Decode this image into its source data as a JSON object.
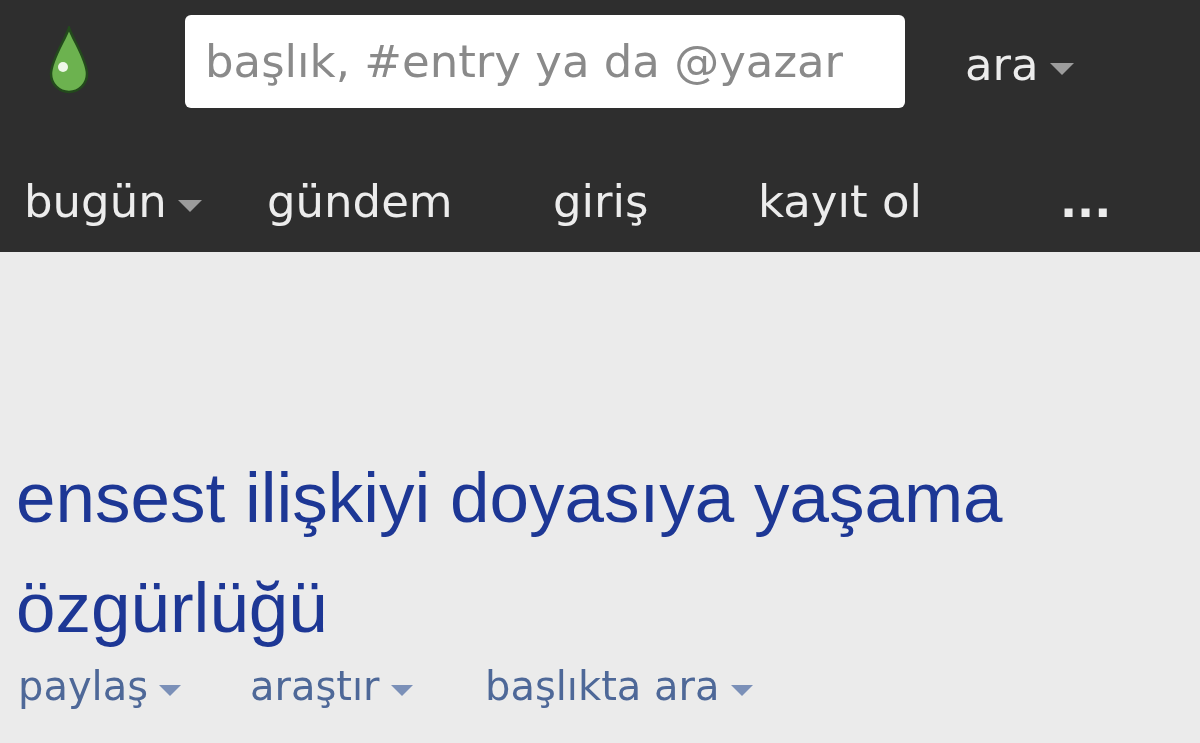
{
  "search": {
    "placeholder": "başlık, #entry ya da @yazar",
    "button": {
      "label": "ara",
      "has_menu": true
    }
  },
  "nav": [
    {
      "label": "bugün",
      "has_menu": true
    },
    {
      "label": "gündem",
      "has_menu": false
    },
    {
      "label": "giriş",
      "has_menu": false
    },
    {
      "label": "kayıt ol",
      "has_menu": false
    },
    {
      "label": "...",
      "has_menu": false
    }
  ],
  "topic": {
    "title": "ensest ilişkiyi doyasıya yaşama özgürlüğü",
    "actions": [
      {
        "label": "paylaş",
        "has_menu": true
      },
      {
        "label": "araştır",
        "has_menu": true
      },
      {
        "label": "başlıkta ara",
        "has_menu": true
      }
    ]
  }
}
